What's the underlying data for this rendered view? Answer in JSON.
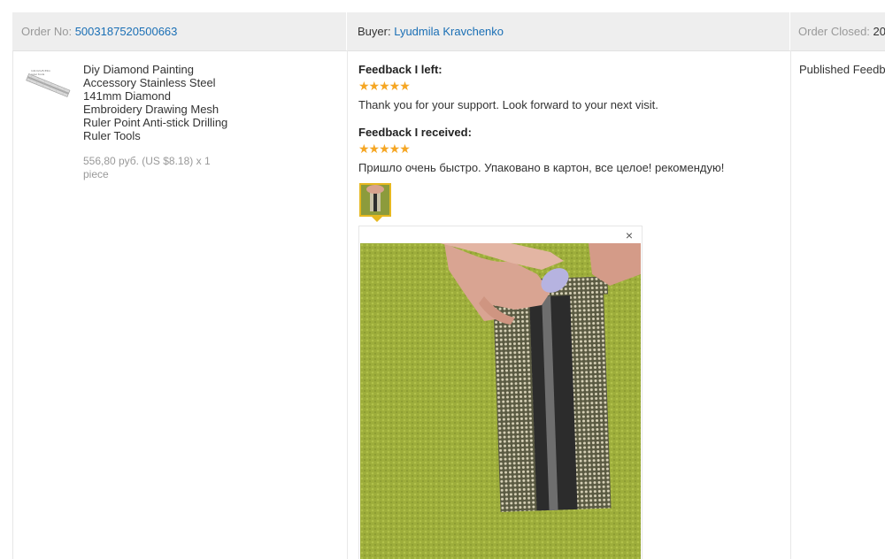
{
  "order": {
    "label": "Order No:",
    "number": "5003187520500663"
  },
  "buyer": {
    "label": "Buyer:",
    "name": "Lyudmila Kravchenko"
  },
  "order_closed": {
    "label": "Order Closed:",
    "value": "20"
  },
  "product": {
    "title": "Diy Diamond Painting Accessory Stainless Steel 141mm Diamond Embroidery Drawing Mesh Ruler Point Anti-stick Drilling Ruler Tools",
    "price": "556,80 руб. (US $8.18) x 1 piece",
    "thumbnail_icon": "ruler-product-image"
  },
  "feedback_left": {
    "label": "Feedback I left:",
    "stars": "★★★★★",
    "rating": 5,
    "text": "Thank you for your support. Look forward to your next visit."
  },
  "feedback_received": {
    "label": "Feedback I received:",
    "stars": "★★★★★",
    "rating": 5,
    "text": "Пришло очень быстро. Упаковано в картон, все целое! рекомендую!"
  },
  "preview": {
    "close": "×"
  },
  "published": {
    "text": "Published Feedba"
  },
  "colors": {
    "link": "#1a6fb5",
    "star": "#f5a623",
    "thumb_border": "#e6b820",
    "header_bg": "#eeeeee"
  }
}
